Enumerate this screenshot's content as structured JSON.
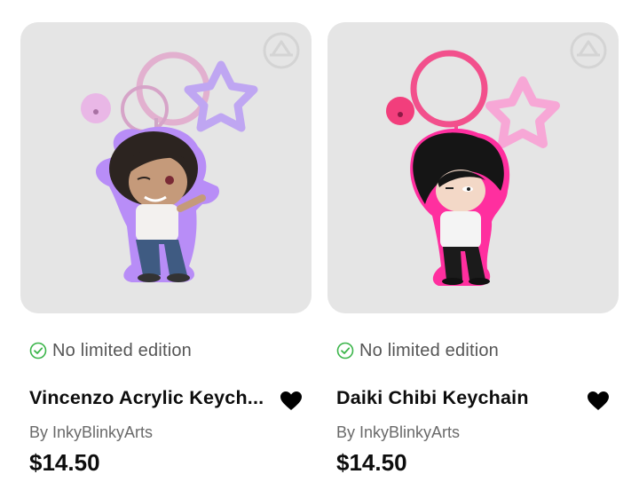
{
  "products": [
    {
      "limited_text": "No limited edition",
      "title": "Vincenzo Acrylic Keych...",
      "seller": "By InkyBlinkyArts",
      "price": "$14.50",
      "image": "vincenzo-acrylic-keychain",
      "accent_color": "#b58cf5",
      "ring_color": "#e3b3d0"
    },
    {
      "limited_text": "No limited edition",
      "title": "Daiki Chibi Keychain",
      "seller": "By InkyBlinkyArts",
      "price": "$14.50",
      "image": "daiki-chibi-keychain",
      "accent_color": "#ff3ca6",
      "ring_color": "#f2508c"
    }
  ],
  "icons": {
    "limited": "check-circle-icon",
    "favorite": "heart-icon",
    "badge": "brand-badge-icon"
  },
  "colors": {
    "check_green": "#3bb54a",
    "card_bg": "#e5e5e5"
  }
}
